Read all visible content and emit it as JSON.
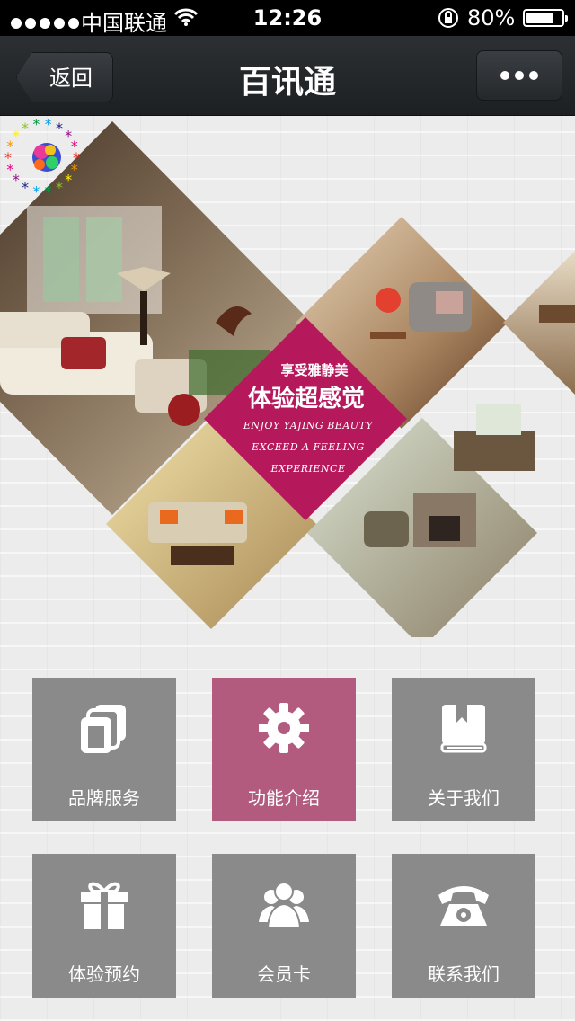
{
  "status_bar": {
    "carrier": "中国联通",
    "time": "12:26",
    "battery": "80%",
    "battery_level": 0.8,
    "signal_icon": "signal-dots-icon",
    "wifi_icon": "wifi-icon",
    "lock_icon": "rotation-lock-icon"
  },
  "nav": {
    "back_label": "返回",
    "title": "百讯通",
    "more_icon": "more-dots-icon"
  },
  "banner": {
    "tagline_cn_small": "享受雅静美",
    "tagline_cn_big": "体验超感觉",
    "tagline_en_1": "ENJOY YAJING BEAUTY",
    "tagline_en_2": "EXCEED A FEELING",
    "tagline_en_3": "EXPERIENCE",
    "accent_color": "#b5195b"
  },
  "tiles": [
    {
      "label": "品牌服务",
      "icon": "folders-icon",
      "color": "#8a8a8a"
    },
    {
      "label": "功能介绍",
      "icon": "gear-icon",
      "color": "#b25b7f"
    },
    {
      "label": "关于我们",
      "icon": "book-icon",
      "color": "#8a8a8a"
    },
    {
      "label": "体验预约",
      "icon": "gift-icon",
      "color": "#8a8a8a"
    },
    {
      "label": "会员卡",
      "icon": "members-icon",
      "color": "#8a8a8a"
    },
    {
      "label": "联系我们",
      "icon": "telephone-icon",
      "color": "#8a8a8a"
    }
  ]
}
